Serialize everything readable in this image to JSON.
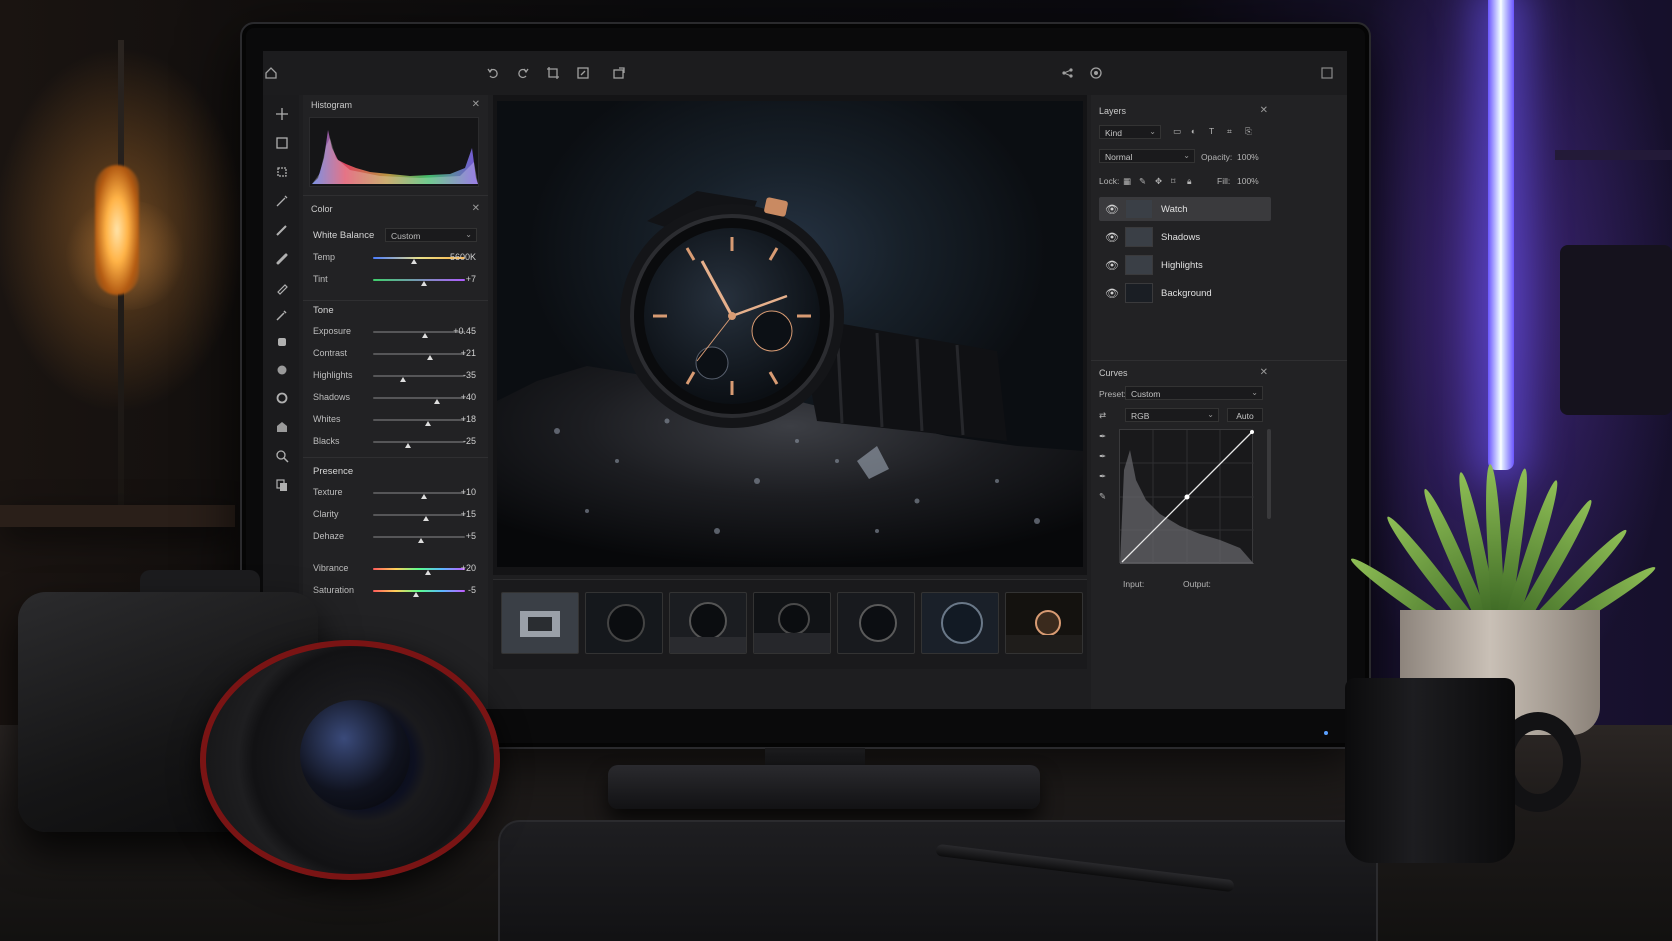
{
  "topbar": {
    "icons": [
      "home-icon",
      "undo-icon",
      "redo-icon",
      "crop-icon",
      "transform-icon",
      "share-icon",
      "link-icon",
      "cloud-icon",
      "expand-icon"
    ]
  },
  "tools": [
    "move-tool-icon",
    "marquee-tool-icon",
    "lasso-tool-icon",
    "magic-wand-icon",
    "brush-tool-icon",
    "healing-tool-icon",
    "pen-tool-icon",
    "eyedropper-icon",
    "stamp-tool-icon",
    "dodge-tool-icon",
    "ellipse-tool-icon",
    "shape-tool-icon",
    "zoom-tool-icon",
    "copy-tool-icon"
  ],
  "histogram": {
    "title": "Histogram"
  },
  "color_panel": {
    "title": "Color",
    "white_balance_label": "White Balance",
    "white_balance_value": "Custom",
    "sliders": [
      {
        "label": "Temp",
        "value": "5600K",
        "pos": 0.45
      },
      {
        "label": "Tint",
        "value": "+7",
        "pos": 0.55
      }
    ]
  },
  "tone": {
    "title": "Tone",
    "sliders": [
      {
        "label": "Exposure",
        "value": "+0.45",
        "pos": 0.57
      },
      {
        "label": "Contrast",
        "value": "+21",
        "pos": 0.62
      },
      {
        "label": "Highlights",
        "value": "-35",
        "pos": 0.33
      },
      {
        "label": "Shadows",
        "value": "+40",
        "pos": 0.7
      },
      {
        "label": "Whites",
        "value": "+18",
        "pos": 0.6
      },
      {
        "label": "Blacks",
        "value": "-25",
        "pos": 0.38
      }
    ]
  },
  "presence": {
    "title": "Presence",
    "sliders": [
      {
        "label": "Texture",
        "value": "+10",
        "pos": 0.55
      },
      {
        "label": "Clarity",
        "value": "+15",
        "pos": 0.58
      },
      {
        "label": "Dehaze",
        "value": "+5",
        "pos": 0.52
      },
      {
        "label": "Vibrance",
        "value": "+20",
        "pos": 0.6
      },
      {
        "label": "Saturation",
        "value": "-5",
        "pos": 0.47
      }
    ]
  },
  "layers_panel": {
    "title": "Layers",
    "kind_label": "Kind",
    "blend_mode": "Normal",
    "opacity_label": "Opacity:",
    "opacity_value": "100%",
    "lock_label": "Lock:",
    "fill_label": "Fill:",
    "fill_value": "100%",
    "layers": [
      {
        "name": "Watch",
        "selected": true
      },
      {
        "name": "Shadows",
        "selected": false
      },
      {
        "name": "Highlights",
        "selected": false
      },
      {
        "name": "Background",
        "selected": false
      }
    ]
  },
  "curves_panel": {
    "title": "Curves",
    "preset_label": "Preset:",
    "preset_value": "Custom",
    "channel": "RGB",
    "auto_label": "Auto",
    "input_label": "Input:",
    "output_label": "Output:"
  },
  "filmstrip": {
    "count": 7,
    "selected_index": 0
  },
  "colors": {
    "panel_bg": "#222224",
    "accent_rose_gold": "#d89b73",
    "selected_layer": "#3a3a3d"
  }
}
